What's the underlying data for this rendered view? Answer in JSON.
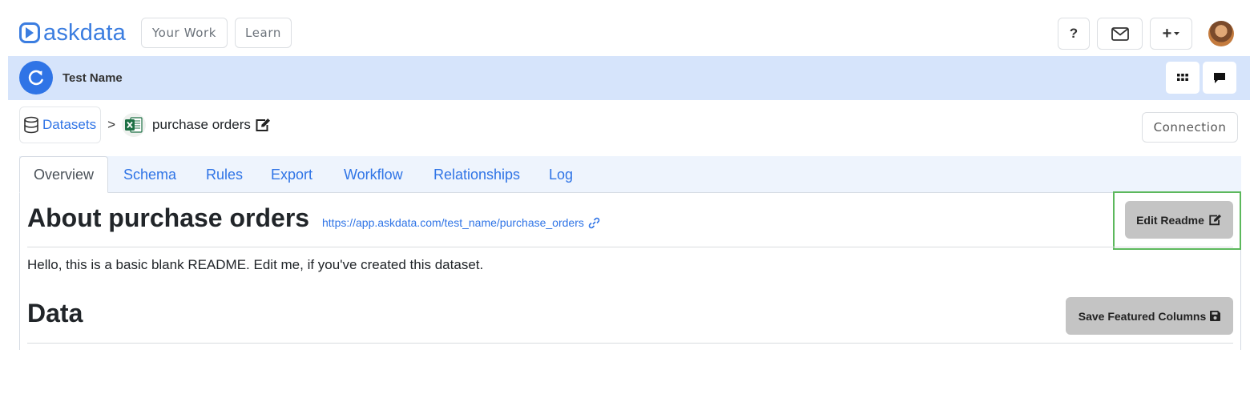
{
  "brand": {
    "name": "askdata",
    "color": "#3b7de0"
  },
  "topnav": {
    "your_work": "Your Work",
    "learn": "Learn",
    "help_label": "?",
    "new_label": "+"
  },
  "workspace": {
    "name": "Test Name",
    "accent": "#2f74e6",
    "bar_color": "#d6e4fb"
  },
  "breadcrumb": {
    "root": "Datasets",
    "separator": ">",
    "current": "purchase orders",
    "file_icon": "excel-icon"
  },
  "connection_label": "Connection",
  "tabs": [
    {
      "label": "Overview",
      "active": true
    },
    {
      "label": "Schema",
      "active": false
    },
    {
      "label": "Rules",
      "active": false
    },
    {
      "label": "Export",
      "active": false
    },
    {
      "label": "Workflow",
      "active": false
    },
    {
      "label": "Relationships",
      "active": false
    },
    {
      "label": "Log",
      "active": false
    }
  ],
  "about": {
    "title": "About purchase orders",
    "url": "https://app.askdata.com/test_name/purchase_orders",
    "edit_label": "Edit Readme",
    "readme": "Hello, this is a basic blank README. Edit me, if you've created this dataset."
  },
  "data_section": {
    "title": "Data",
    "save_label": "Save Featured Columns"
  },
  "highlight_color": "#5cb85c"
}
